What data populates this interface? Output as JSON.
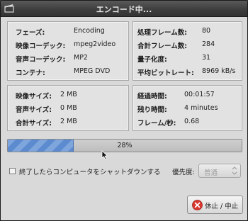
{
  "window": {
    "title": "エンコード中..."
  },
  "info": {
    "rows": [
      {
        "label": "フェーズ:",
        "value": "Encoding"
      },
      {
        "label": "映像コーデック:",
        "value": "mpeg2video"
      },
      {
        "label": "音声コーデック:",
        "value": "MP2"
      },
      {
        "label": "コンテナ:",
        "value": "MPEG DVD"
      }
    ]
  },
  "frames": {
    "rows": [
      {
        "label": "処理フレーム数:",
        "value": "80"
      },
      {
        "label": "合計フレーム数:",
        "value": "284"
      },
      {
        "label": "量子化度:",
        "value": "31"
      },
      {
        "label": "平均ビットレート:",
        "value": "8969 kB/s"
      }
    ]
  },
  "sizes": {
    "rows": [
      {
        "label": "映像サイズ:",
        "value": "2 MB"
      },
      {
        "label": "音声サイズ:",
        "value": "0 MB"
      },
      {
        "label": "合計サイズ:",
        "value": "2 MB"
      }
    ]
  },
  "timing": {
    "rows": [
      {
        "label": "経過時間:",
        "value": "00:01:57"
      },
      {
        "label": "残り時間:",
        "value": "4 minutes"
      },
      {
        "label": "フレーム/秒:",
        "value": "0.68"
      }
    ]
  },
  "progress": {
    "fraction": 0.28,
    "text": "28%"
  },
  "shutdown_checkbox": {
    "label": "終了したらコンピュータをシャットダウンする",
    "checked": false
  },
  "priority": {
    "label": "優先度:",
    "value": "普通"
  },
  "stop_button": {
    "label": "休止 / 中止"
  },
  "icons": {
    "app": "film-clapper-icon",
    "stop": "stop-x-icon",
    "combo": "spinner-arrows-icon",
    "cursor": "mouse-pointer-icon"
  },
  "colors": {
    "progress_fill": "#6f9ad8",
    "stop_icon": "#d9362e"
  }
}
